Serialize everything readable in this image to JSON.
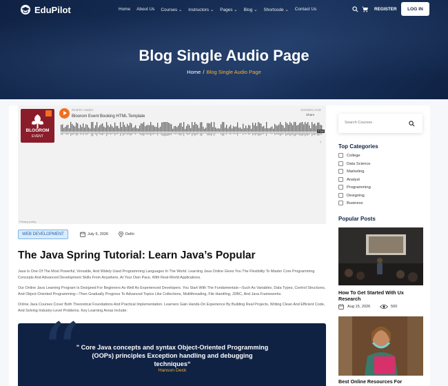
{
  "brand": {
    "name": "EduPilot"
  },
  "nav": {
    "items": [
      "Home",
      "About Us",
      "Courses ⌄",
      "Instructors ⌄",
      "Pages ⌄",
      "Blog ⌄",
      "Shortcode ⌄",
      "Contact Us"
    ],
    "register_label": "REGISTER",
    "login_label": "LOG IN"
  },
  "hero": {
    "title": "Blog Single Audio Page",
    "breadcrumb_home": "Home",
    "breadcrumb_sep": "/",
    "breadcrumb_current": "Blog Single Audio Page"
  },
  "audio": {
    "cover_title": "BLOOROM",
    "cover_subtitle": "EVENT",
    "artist": "Ibrahim Haider",
    "track": "Bloorom Event Booking HTML Template",
    "provider": "SOUNDCLOUD",
    "share_label": "Share",
    "time": "7:13",
    "comments": "7",
    "privacy": "Privacy policy"
  },
  "post": {
    "category": "WEB DEVELOPMENT",
    "date": "July 5, 2026",
    "location": "Delhi",
    "title": "The Java Spring Tutorial: Learn Java’s Popular",
    "paragraphs": [
      "Java Is One Of The Most Powerful, Versatile, And Widely Used Programming Languages In The World. Learning Java Online Gives You The Flexibility To Master Core Programming Concepts And Advanced Development Skills From Anywhere, At Your Own Pace, With Real-World Applications.",
      "Our Online Java Learning Program Is Designed For Beginners As Well As Experienced Developers. You Start With The Fundamentals—Such As Variables, Data Types, Control Structures, And Object-Oriented Programming—Then Gradually Progress To Advanced Topics Like Collections, Multithreading, File Handling, JDBC, And Java Frameworks.",
      "Online Java Courses Cover Both Theoretical Foundations And Practical Implementation. Learners Gain Hands-On Experience By Building Real Projects, Writing Clean And Efficient Code, And Solving Industry-Level Problems. Key Learning Areas Include:"
    ],
    "quote_text": "\" Core Java concepts and syntax Object-Oriented Programming (OOPs) principles Exception handling and debugging techniques“",
    "quote_author": "Hanson Deck"
  },
  "sidebar": {
    "search_placeholder": "Search Courses",
    "categories_heading": "Top Categories",
    "categories": [
      "College",
      "Data Science",
      "Marketing",
      "Analyst",
      "Programming",
      "Designing",
      "Business"
    ],
    "popular_heading": "Popular Posts",
    "posts": [
      {
        "title": "How To Get Started With Ux Research",
        "date": "Aug 15, 2026",
        "views": "500"
      },
      {
        "title": "Best Online Resources For"
      }
    ]
  },
  "colors": {
    "navy": "#0f2244",
    "accent": "#f2b233",
    "orange": "#f26f21"
  }
}
